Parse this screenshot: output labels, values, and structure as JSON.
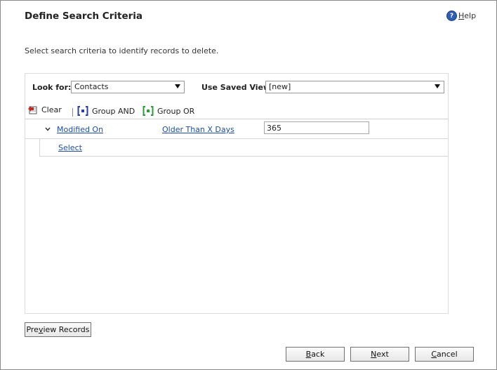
{
  "dialog": {
    "title": "Define Search Criteria",
    "help": {
      "prefix": "",
      "accel": "H",
      "rest": "elp"
    },
    "instructions": "Select search criteria to identify records to delete."
  },
  "query": {
    "look_for_label": "Look for:",
    "look_for_value": "Contacts",
    "saved_view_label": "Use Saved View:",
    "saved_view_value": "[new]"
  },
  "toolbar": {
    "clear": "Clear",
    "group_and": "Group AND",
    "group_or": "Group OR"
  },
  "condition": {
    "field": "Modified On",
    "operator": "Older Than X Days",
    "value": "365"
  },
  "add_row": {
    "select_label": "Select"
  },
  "buttons": {
    "preview": {
      "pre": "Pre",
      "accel": "v",
      "post": "iew Records"
    },
    "back": {
      "pre": "",
      "accel": "B",
      "post": "ack"
    },
    "next": {
      "pre": "",
      "accel": "N",
      "post": "ext"
    },
    "cancel": {
      "pre": "",
      "accel": "C",
      "post": "ancel"
    }
  }
}
